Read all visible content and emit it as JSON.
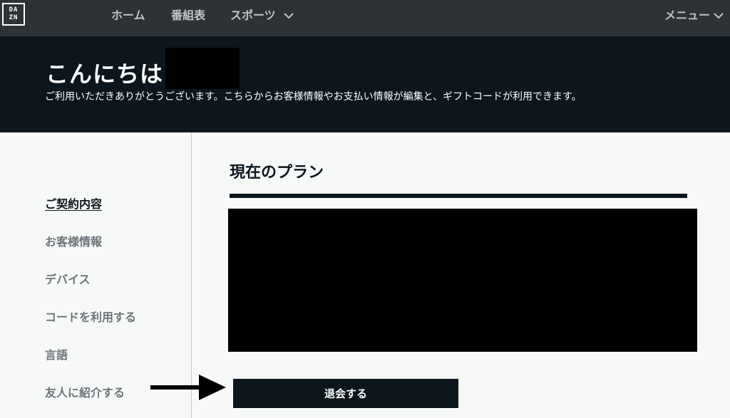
{
  "logo": {
    "line1": "DA",
    "line2": "ZN"
  },
  "nav": {
    "items": [
      {
        "label": "ホーム"
      },
      {
        "label": "番組表"
      },
      {
        "label": "スポーツ"
      }
    ],
    "menu_label": "メニュー",
    "icons": {
      "dropdown": "chevron-down-icon"
    }
  },
  "banner": {
    "greeting": "こんにちは",
    "subtitle": "ご利用いただきありがとうございます。こちらからお客様情報やお支払い情報が編集と、ギフトコードが利用できます。"
  },
  "sidebar": {
    "items": [
      {
        "label": "ご契約内容",
        "active": true
      },
      {
        "label": "お客様情報",
        "active": false
      },
      {
        "label": "デバイス",
        "active": false
      },
      {
        "label": "コードを利用する",
        "active": false
      },
      {
        "label": "言語",
        "active": false
      },
      {
        "label": "友人に紹介する",
        "active": false
      }
    ]
  },
  "main": {
    "plan_title": "現在のプラン",
    "cancel_button": "退会する"
  },
  "colors": {
    "topbar": "#2d3236",
    "banner": "#0c161c",
    "background": "#f7f9f9",
    "nav_text": "#c1c5c8",
    "sidebar_text": "#6e7479",
    "button": "#0c161c"
  }
}
